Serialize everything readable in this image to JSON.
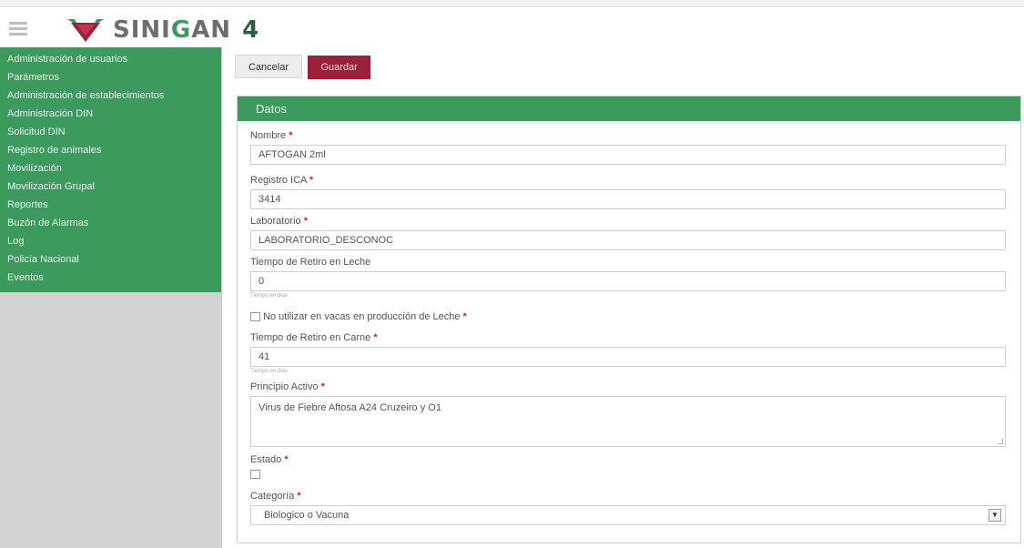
{
  "header": {
    "brand_prefix": "SINI",
    "brand_g": "G",
    "brand_suffix": "AN",
    "version": "4",
    "menu_icon": "hamburger-icon",
    "logo_icon": "bull-logo-icon"
  },
  "sidebar": {
    "items": [
      {
        "label": "Administración de usuarios"
      },
      {
        "label": "Parámetros"
      },
      {
        "label": "Administración de establecimientos"
      },
      {
        "label": "Administración DIN"
      },
      {
        "label": "Solicitud DIN"
      },
      {
        "label": "Registro de animales"
      },
      {
        "label": "Movilización"
      },
      {
        "label": "Movilización Grupal"
      },
      {
        "label": "Reportes"
      },
      {
        "label": "Buzón de Alarmas"
      },
      {
        "label": "Log"
      },
      {
        "label": "Policía Nacional"
      },
      {
        "label": "Eventos"
      }
    ]
  },
  "toolbar": {
    "cancel_label": "Cancelar",
    "save_label": "Guardar"
  },
  "panel": {
    "title": "Datos"
  },
  "form": {
    "nombre": {
      "label": "Nombre",
      "value": "AFTOGAN 2ml"
    },
    "registro": {
      "label": "Registro ICA",
      "value": "3414"
    },
    "laboratorio": {
      "label": "Laboratorio",
      "value": "LABORATORIO_DESCONOC"
    },
    "retiro_leche": {
      "label": "Tiempo de Retiro en Leche",
      "value": "0",
      "help": "Tiempo en días"
    },
    "no_vacas": {
      "label": "No utilizar en vacas en producción de Leche"
    },
    "retiro_carne": {
      "label": "Tiempo de Retiro en Carne",
      "value": "41",
      "help": "Tiempo en días"
    },
    "principio": {
      "label": "Principio Activo",
      "value": "Virus de Fiebre Aftosa A24 Cruzeiro y O1"
    },
    "estado": {
      "label": "Estado"
    },
    "categoria": {
      "label": "Categoría",
      "value": "Biologico o Vacuna"
    },
    "required_mark": "*"
  },
  "colors": {
    "green": "#3c9a5f",
    "save": "#9b2039"
  }
}
